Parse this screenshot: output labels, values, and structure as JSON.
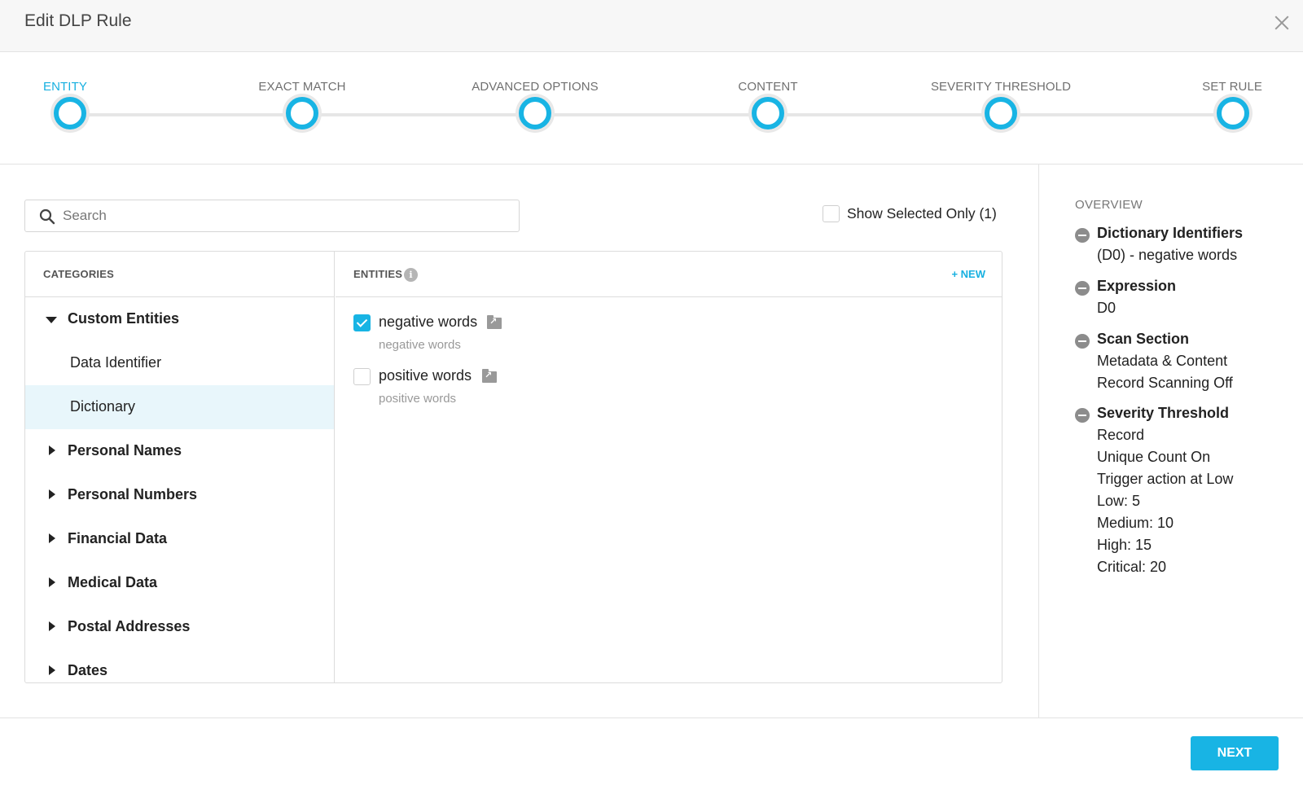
{
  "dialog": {
    "title": "Edit DLP Rule"
  },
  "steps": [
    "ENTITY",
    "EXACT MATCH",
    "ADVANCED OPTIONS",
    "CONTENT",
    "SEVERITY THRESHOLD",
    "SET RULE"
  ],
  "active_step": "ENTITY",
  "search": {
    "placeholder": "Search",
    "value": ""
  },
  "show_selected": {
    "label": "Show Selected Only (1)",
    "checked": false
  },
  "categories": {
    "header": "CATEGORIES",
    "items": [
      {
        "label": "Custom Entities",
        "expanded": true,
        "level": 0
      },
      {
        "label": "Data Identifier",
        "level": 1
      },
      {
        "label": "Dictionary",
        "level": 1,
        "selected": true
      },
      {
        "label": "Personal Names",
        "expanded": false,
        "level": 0
      },
      {
        "label": "Personal Numbers",
        "expanded": false,
        "level": 0
      },
      {
        "label": "Financial Data",
        "expanded": false,
        "level": 0
      },
      {
        "label": "Medical Data",
        "expanded": false,
        "level": 0
      },
      {
        "label": "Postal Addresses",
        "expanded": false,
        "level": 0
      },
      {
        "label": "Dates",
        "expanded": false,
        "level": 0
      }
    ]
  },
  "entities": {
    "header": "ENTITIES",
    "info_icon": "info-icon",
    "new_label": "+ NEW",
    "items": [
      {
        "name": "negative words",
        "description": "negative words",
        "checked": true
      },
      {
        "name": "positive words",
        "description": "positive words",
        "checked": false
      }
    ]
  },
  "overview": {
    "title": "OVERVIEW",
    "sections": [
      {
        "title": "Dictionary Identifiers",
        "lines": [
          "(D0) - negative words"
        ]
      },
      {
        "title": "Expression",
        "lines": [
          "D0"
        ]
      },
      {
        "title": "Scan Section",
        "lines": [
          "Metadata & Content",
          "Record Scanning Off"
        ]
      },
      {
        "title": "Severity Threshold",
        "lines": [
          "Record",
          "Unique Count On",
          "Trigger action at Low",
          "Low: 5",
          "Medium: 10",
          "High: 15",
          "Critical: 20"
        ]
      }
    ]
  },
  "footer": {
    "next_label": "NEXT"
  },
  "colors": {
    "accent": "#18b4e4",
    "selected_row": "#e8f6fb",
    "active_step_label": "#17b0e0"
  }
}
